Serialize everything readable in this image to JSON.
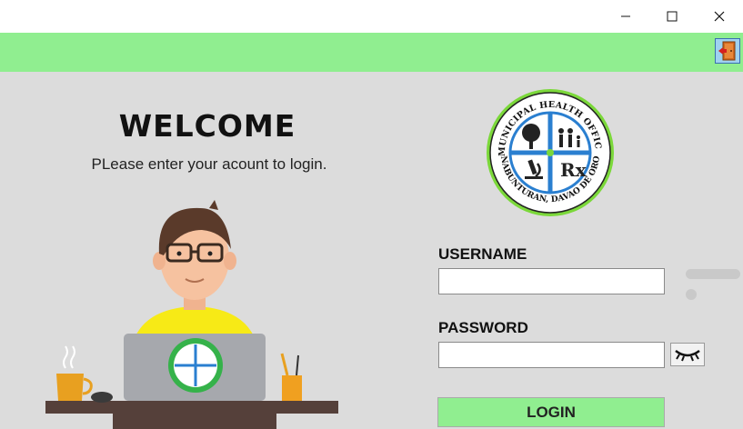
{
  "window": {
    "minimize_icon": "minimize-icon",
    "maximize_icon": "maximize-icon",
    "close_icon": "close-icon"
  },
  "header": {
    "background_color": "#90ee90",
    "exit_icon": "exit-door-icon"
  },
  "welcome": {
    "title": "WELCOME",
    "subtitle": "PLease enter your acount to login."
  },
  "logo": {
    "top_text": "MUNICIPAL HEALTH OFFICE",
    "bottom_text": "NABUNTURAN, DAVAO DE ORO",
    "quadrant_icons": [
      "tree-icon",
      "family-icon",
      "microscope-icon",
      "rx-icon"
    ]
  },
  "form": {
    "username_label": "USERNAME",
    "username_value": "",
    "password_label": "PASSWORD",
    "password_value": "",
    "show_password_icon": "closed-eye-icon",
    "login_label": "LOGIN",
    "login_color": "#90ee90"
  },
  "illustration": {
    "description_icon": "person-at-laptop-illustration"
  }
}
